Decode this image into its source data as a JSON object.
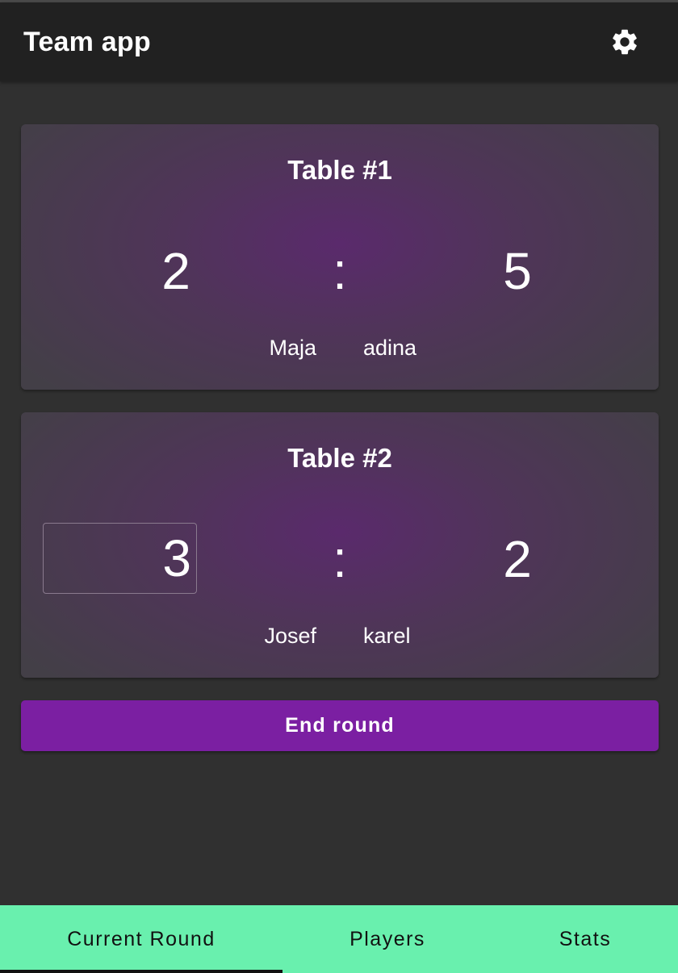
{
  "app": {
    "title": "Team app",
    "settings_icon": "gear-icon"
  },
  "tables": [
    {
      "title": "Table #1",
      "score_a": "2",
      "separator": ":",
      "score_b": "5",
      "player_a": "Maja",
      "player_b": "adina"
    },
    {
      "title": "Table #2",
      "score_a": "3",
      "separator": ":",
      "score_b": "2",
      "player_a": "Josef",
      "player_b": "karel"
    }
  ],
  "actions": {
    "end_round_label": "End round"
  },
  "nav": {
    "tabs": [
      {
        "label": "Current Round",
        "active": true
      },
      {
        "label": "Players",
        "active": false
      },
      {
        "label": "Stats",
        "active": false
      }
    ]
  },
  "colors": {
    "appbar": "#212121",
    "background": "#303030",
    "accent": "#7b1fa2",
    "nav": "#69f0ae"
  }
}
